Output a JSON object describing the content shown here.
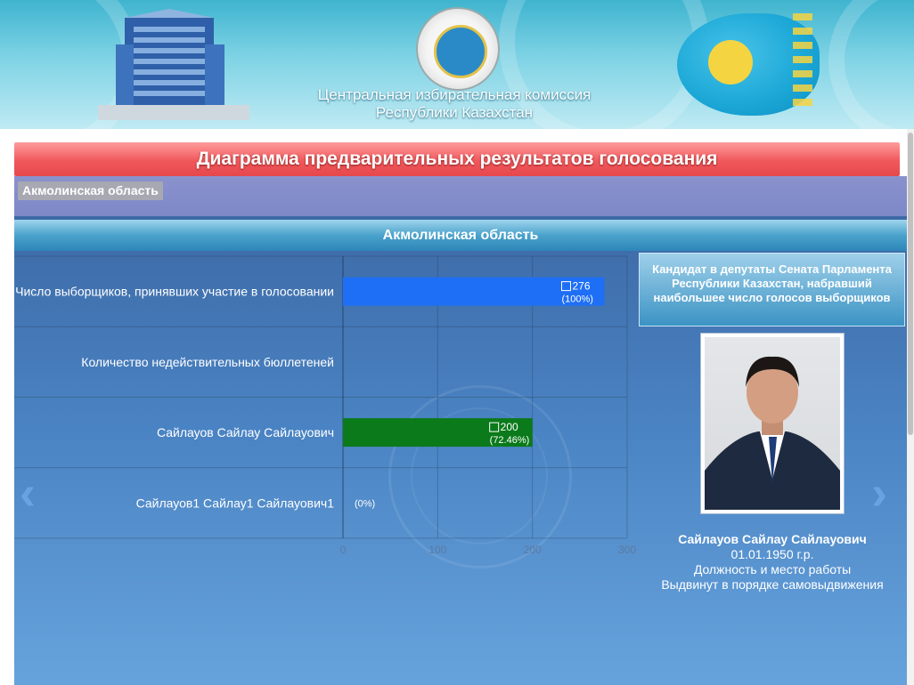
{
  "header": {
    "org_line1": "Центральная избирательная комиссия",
    "org_line2": "Республики Казахстан"
  },
  "page_title": "Диаграмма предварительных результатов голосования",
  "region_chip": "Акмолинская область",
  "colors": {
    "title_bar": "#f0585c",
    "region_strip": "#7d88c8",
    "chart_bg": "#4a83c3",
    "bar_total": "#1e6ff5",
    "bar_candidate": "#0a7a1a"
  },
  "chart_data": {
    "type": "bar",
    "orientation": "horizontal",
    "title": "Акмолинская область",
    "categories": [
      "Число выборщиков, принявших участие в голосовании",
      "Количество недействительных бюллетеней",
      "Сайлауов Сайлау Сайлауович",
      "Сайлауов1 Сайлау1 Сайлауович1"
    ],
    "values": [
      276,
      0,
      200,
      0
    ],
    "value_labels": [
      "276",
      "",
      "200",
      ""
    ],
    "percent_labels": [
      "(100%)",
      "",
      "(72.46%)",
      "(0%)"
    ],
    "bar_colors": [
      "#1e6ff5",
      "",
      "#0a7a1a",
      ""
    ],
    "xlim": [
      0,
      300
    ],
    "xticks": [
      "0",
      "100",
      "200",
      "300"
    ],
    "grid": true
  },
  "candidate": {
    "heading": "Кандидат в депутаты Сената Парламента Республики Казахстан, набравший наибольшее число голосов выборщиков",
    "name": "Сайлауов Сайлау Сайлауович",
    "birth": "01.01.1950 г.р.",
    "position": "Должность и место работы",
    "nomination": "Выдвинут в порядке самовыдвижения"
  },
  "icons": {
    "prev": "chevron-left-icon",
    "next": "chevron-right-icon"
  }
}
